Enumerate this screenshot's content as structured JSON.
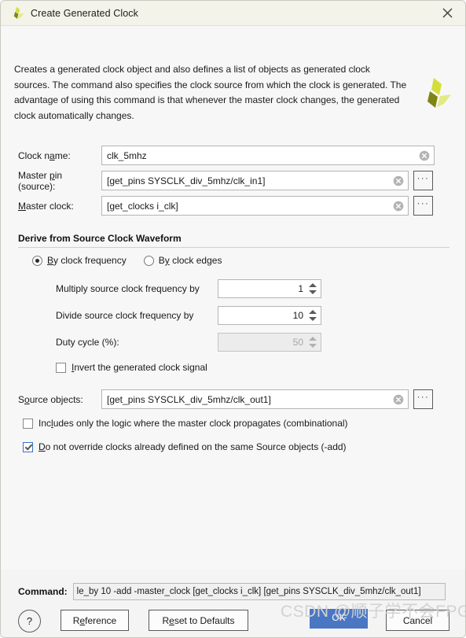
{
  "window": {
    "title": "Create Generated Clock",
    "logo_icon": "vivado-logo-icon",
    "close_icon": "close-icon"
  },
  "description": "Creates a generated clock object and also defines a list of objects as generated clock sources. The command also specifies the clock source from which the clock is generated. The advantage of using this command is that whenever the master clock changes, the generated clock automatically changes.",
  "fields": {
    "clock_name": {
      "label_pre": "Clock n",
      "label_key": "a",
      "label_post": "me:",
      "value": "clk_5mhz",
      "clear_icon": "clear-icon"
    },
    "master_pin": {
      "label_pre": "Master ",
      "label_key": "p",
      "label_post": "in (source):",
      "value": "[get_pins SYSCLK_div_5mhz/clk_in1]",
      "clear_icon": "clear-icon",
      "browse_label": "···"
    },
    "master_clock": {
      "label_pre": "",
      "label_key": "M",
      "label_post": "aster clock:",
      "value": "[get_clocks i_clk]",
      "clear_icon": "clear-icon",
      "browse_label": "···"
    },
    "source_objects": {
      "label_pre": "S",
      "label_key": "o",
      "label_post": "urce objects:",
      "value": "[get_pins SYSCLK_div_5mhz/clk_out1]",
      "clear_icon": "clear-icon",
      "browse_label": "···"
    }
  },
  "group": {
    "title": "Derive from Source Clock Waveform",
    "radios": [
      {
        "pre": "",
        "key": "B",
        "post": "y clock frequency",
        "selected": true
      },
      {
        "pre": "B",
        "key": "y",
        "post": " clock edges",
        "selected": false
      }
    ],
    "spinners": [
      {
        "label": "Multiply source clock frequency by",
        "value": "1",
        "disabled": false
      },
      {
        "label": "Divide source clock frequency by",
        "value": "10",
        "disabled": false
      },
      {
        "label": "Duty cycle (%):",
        "value": "50",
        "disabled": true
      }
    ],
    "invert_checkbox": {
      "pre": "",
      "key": "I",
      "post": "nvert the generated clock signal",
      "checked": false
    }
  },
  "checkboxes": [
    {
      "pre": "Inc",
      "key": "l",
      "post": "udes only the logic where the master clock propagates (combinational)",
      "checked": false
    },
    {
      "pre": "",
      "key": "D",
      "post": "o not override clocks already defined on the same Source objects (-add)",
      "checked": true
    }
  ],
  "footer": {
    "command_label": "Command:",
    "command_value": "le_by 10 -add -master_clock [get_clocks i_clk] [get_pins SYSCLK_div_5mhz/clk_out1]",
    "help_label": "?",
    "buttons": {
      "reference": {
        "pre": "R",
        "key": "e",
        "post": "ference"
      },
      "reset": {
        "pre": "R",
        "key": "e",
        "post": "set to Defaults"
      },
      "ok": "OK",
      "cancel": "Cancel"
    }
  },
  "watermark": "CSDN @顺子学不会FPGA",
  "colors": {
    "accent_blue": "#4a77c4",
    "titlebar": "#f3f3e9",
    "body": "#f7f7f7",
    "logo_dark": "#7f8416",
    "logo_mid": "#d4de3a",
    "logo_light": "#e3ea83"
  }
}
